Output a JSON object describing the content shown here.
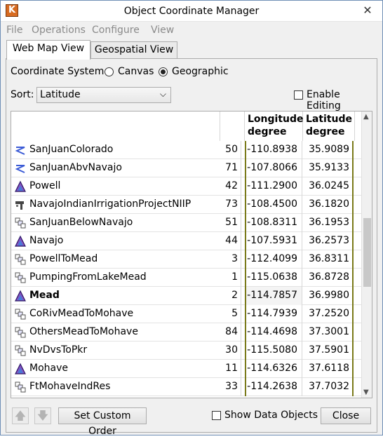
{
  "window": {
    "title": "Object Coordinate Manager",
    "close_glyph": "✕"
  },
  "menu": [
    "File",
    "Operations",
    "Configure",
    "View"
  ],
  "tabs": [
    {
      "label": "Web Map View",
      "active": true
    },
    {
      "label": "Geospatial View",
      "active": false
    }
  ],
  "coordinate_system": {
    "label": "Coordinate System:",
    "options": [
      "Canvas",
      "Geographic"
    ],
    "selected": "Geographic"
  },
  "sort": {
    "label": "Sort:",
    "value": "Latitude"
  },
  "enable_editing": {
    "label": "Enable Editing",
    "checked": false
  },
  "table": {
    "headers": {
      "longitude": [
        "Longitude",
        "degree"
      ],
      "latitude": [
        "Latitude",
        "degree"
      ]
    },
    "rows": [
      {
        "icon": "reach-icon",
        "name": "SanJuanColorado",
        "id": "50",
        "lon": "-110.8938",
        "lat": "35.9089",
        "bold": false
      },
      {
        "icon": "reach-icon",
        "name": "SanJuanAbvNavajo",
        "id": "71",
        "lon": "-107.8066",
        "lat": "35.9133",
        "bold": false
      },
      {
        "icon": "reservoir-icon",
        "name": "Powell",
        "id": "42",
        "lon": "-111.2900",
        "lat": "36.0245",
        "bold": false
      },
      {
        "icon": "diversion-icon",
        "name": "NavajoIndianIrrigationProjectNIIP",
        "id": "73",
        "lon": "-108.4500",
        "lat": "36.1820",
        "bold": false
      },
      {
        "icon": "confluence-icon",
        "name": "SanJuanBelowNavajo",
        "id": "51",
        "lon": "-108.8311",
        "lat": "36.1953",
        "bold": false
      },
      {
        "icon": "reservoir-icon",
        "name": "Navajo",
        "id": "44",
        "lon": "-107.5931",
        "lat": "36.2573",
        "bold": false
      },
      {
        "icon": "confluence-icon",
        "name": "PowellToMead",
        "id": "3",
        "lon": "-112.4099",
        "lat": "36.8311",
        "bold": false
      },
      {
        "icon": "confluence-icon",
        "name": "PumpingFromLakeMead",
        "id": "1",
        "lon": "-115.0638",
        "lat": "36.8728",
        "bold": false
      },
      {
        "icon": "reservoir-icon",
        "name": "Mead",
        "id": "2",
        "lon": "-114.7857",
        "lat": "36.9980",
        "bold": true
      },
      {
        "icon": "confluence-icon",
        "name": "CoRivMeadToMohave",
        "id": "5",
        "lon": "-114.7939",
        "lat": "37.2520",
        "bold": false
      },
      {
        "icon": "confluence-icon",
        "name": "OthersMeadToMohave",
        "id": "84",
        "lon": "-114.4698",
        "lat": "37.3001",
        "bold": false
      },
      {
        "icon": "confluence-icon",
        "name": "NvDvsToPkr",
        "id": "30",
        "lon": "-115.5080",
        "lat": "37.5901",
        "bold": false
      },
      {
        "icon": "reservoir-icon",
        "name": "Mohave",
        "id": "11",
        "lon": "-114.6326",
        "lat": "37.6118",
        "bold": false
      },
      {
        "icon": "confluence-icon",
        "name": "FtMohaveIndRes",
        "id": "33",
        "lon": "-114.2638",
        "lat": "37.7032",
        "bold": false
      }
    ]
  },
  "footer": {
    "custom_order": "Set Custom Order",
    "show_data_objects": "Show Data Objects",
    "close": "Close"
  }
}
